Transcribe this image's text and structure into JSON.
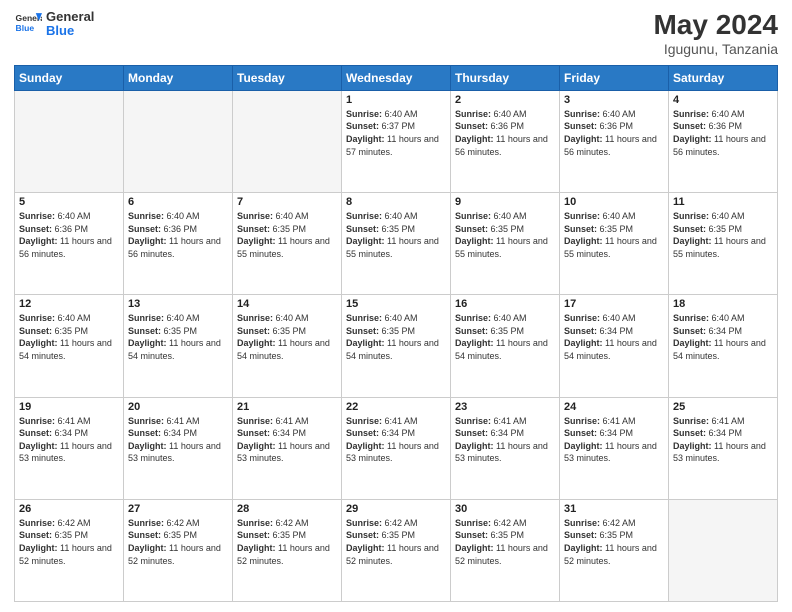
{
  "logo": {
    "line1": "General",
    "line2": "Blue"
  },
  "title": "May 2024",
  "subtitle": "Igugunu, Tanzania",
  "header": {
    "days": [
      "Sunday",
      "Monday",
      "Tuesday",
      "Wednesday",
      "Thursday",
      "Friday",
      "Saturday"
    ]
  },
  "weeks": [
    {
      "cells": [
        {
          "day": "",
          "empty": true
        },
        {
          "day": "",
          "empty": true
        },
        {
          "day": "",
          "empty": true
        },
        {
          "day": "1",
          "sunrise": "6:40 AM",
          "sunset": "6:37 PM",
          "daylight": "11 hours and 57 minutes."
        },
        {
          "day": "2",
          "sunrise": "6:40 AM",
          "sunset": "6:36 PM",
          "daylight": "11 hours and 56 minutes."
        },
        {
          "day": "3",
          "sunrise": "6:40 AM",
          "sunset": "6:36 PM",
          "daylight": "11 hours and 56 minutes."
        },
        {
          "day": "4",
          "sunrise": "6:40 AM",
          "sunset": "6:36 PM",
          "daylight": "11 hours and 56 minutes."
        }
      ]
    },
    {
      "cells": [
        {
          "day": "5",
          "sunrise": "6:40 AM",
          "sunset": "6:36 PM",
          "daylight": "11 hours and 56 minutes."
        },
        {
          "day": "6",
          "sunrise": "6:40 AM",
          "sunset": "6:36 PM",
          "daylight": "11 hours and 56 minutes."
        },
        {
          "day": "7",
          "sunrise": "6:40 AM",
          "sunset": "6:35 PM",
          "daylight": "11 hours and 55 minutes."
        },
        {
          "day": "8",
          "sunrise": "6:40 AM",
          "sunset": "6:35 PM",
          "daylight": "11 hours and 55 minutes."
        },
        {
          "day": "9",
          "sunrise": "6:40 AM",
          "sunset": "6:35 PM",
          "daylight": "11 hours and 55 minutes."
        },
        {
          "day": "10",
          "sunrise": "6:40 AM",
          "sunset": "6:35 PM",
          "daylight": "11 hours and 55 minutes."
        },
        {
          "day": "11",
          "sunrise": "6:40 AM",
          "sunset": "6:35 PM",
          "daylight": "11 hours and 55 minutes."
        }
      ]
    },
    {
      "cells": [
        {
          "day": "12",
          "sunrise": "6:40 AM",
          "sunset": "6:35 PM",
          "daylight": "11 hours and 54 minutes."
        },
        {
          "day": "13",
          "sunrise": "6:40 AM",
          "sunset": "6:35 PM",
          "daylight": "11 hours and 54 minutes."
        },
        {
          "day": "14",
          "sunrise": "6:40 AM",
          "sunset": "6:35 PM",
          "daylight": "11 hours and 54 minutes."
        },
        {
          "day": "15",
          "sunrise": "6:40 AM",
          "sunset": "6:35 PM",
          "daylight": "11 hours and 54 minutes."
        },
        {
          "day": "16",
          "sunrise": "6:40 AM",
          "sunset": "6:35 PM",
          "daylight": "11 hours and 54 minutes."
        },
        {
          "day": "17",
          "sunrise": "6:40 AM",
          "sunset": "6:34 PM",
          "daylight": "11 hours and 54 minutes."
        },
        {
          "day": "18",
          "sunrise": "6:40 AM",
          "sunset": "6:34 PM",
          "daylight": "11 hours and 54 minutes."
        }
      ]
    },
    {
      "cells": [
        {
          "day": "19",
          "sunrise": "6:41 AM",
          "sunset": "6:34 PM",
          "daylight": "11 hours and 53 minutes."
        },
        {
          "day": "20",
          "sunrise": "6:41 AM",
          "sunset": "6:34 PM",
          "daylight": "11 hours and 53 minutes."
        },
        {
          "day": "21",
          "sunrise": "6:41 AM",
          "sunset": "6:34 PM",
          "daylight": "11 hours and 53 minutes."
        },
        {
          "day": "22",
          "sunrise": "6:41 AM",
          "sunset": "6:34 PM",
          "daylight": "11 hours and 53 minutes."
        },
        {
          "day": "23",
          "sunrise": "6:41 AM",
          "sunset": "6:34 PM",
          "daylight": "11 hours and 53 minutes."
        },
        {
          "day": "24",
          "sunrise": "6:41 AM",
          "sunset": "6:34 PM",
          "daylight": "11 hours and 53 minutes."
        },
        {
          "day": "25",
          "sunrise": "6:41 AM",
          "sunset": "6:34 PM",
          "daylight": "11 hours and 53 minutes."
        }
      ]
    },
    {
      "cells": [
        {
          "day": "26",
          "sunrise": "6:42 AM",
          "sunset": "6:35 PM",
          "daylight": "11 hours and 52 minutes."
        },
        {
          "day": "27",
          "sunrise": "6:42 AM",
          "sunset": "6:35 PM",
          "daylight": "11 hours and 52 minutes."
        },
        {
          "day": "28",
          "sunrise": "6:42 AM",
          "sunset": "6:35 PM",
          "daylight": "11 hours and 52 minutes."
        },
        {
          "day": "29",
          "sunrise": "6:42 AM",
          "sunset": "6:35 PM",
          "daylight": "11 hours and 52 minutes."
        },
        {
          "day": "30",
          "sunrise": "6:42 AM",
          "sunset": "6:35 PM",
          "daylight": "11 hours and 52 minutes."
        },
        {
          "day": "31",
          "sunrise": "6:42 AM",
          "sunset": "6:35 PM",
          "daylight": "11 hours and 52 minutes."
        },
        {
          "day": "",
          "empty": true
        }
      ]
    }
  ],
  "labels": {
    "sunrise": "Sunrise:",
    "sunset": "Sunset:",
    "daylight": "Daylight:"
  }
}
